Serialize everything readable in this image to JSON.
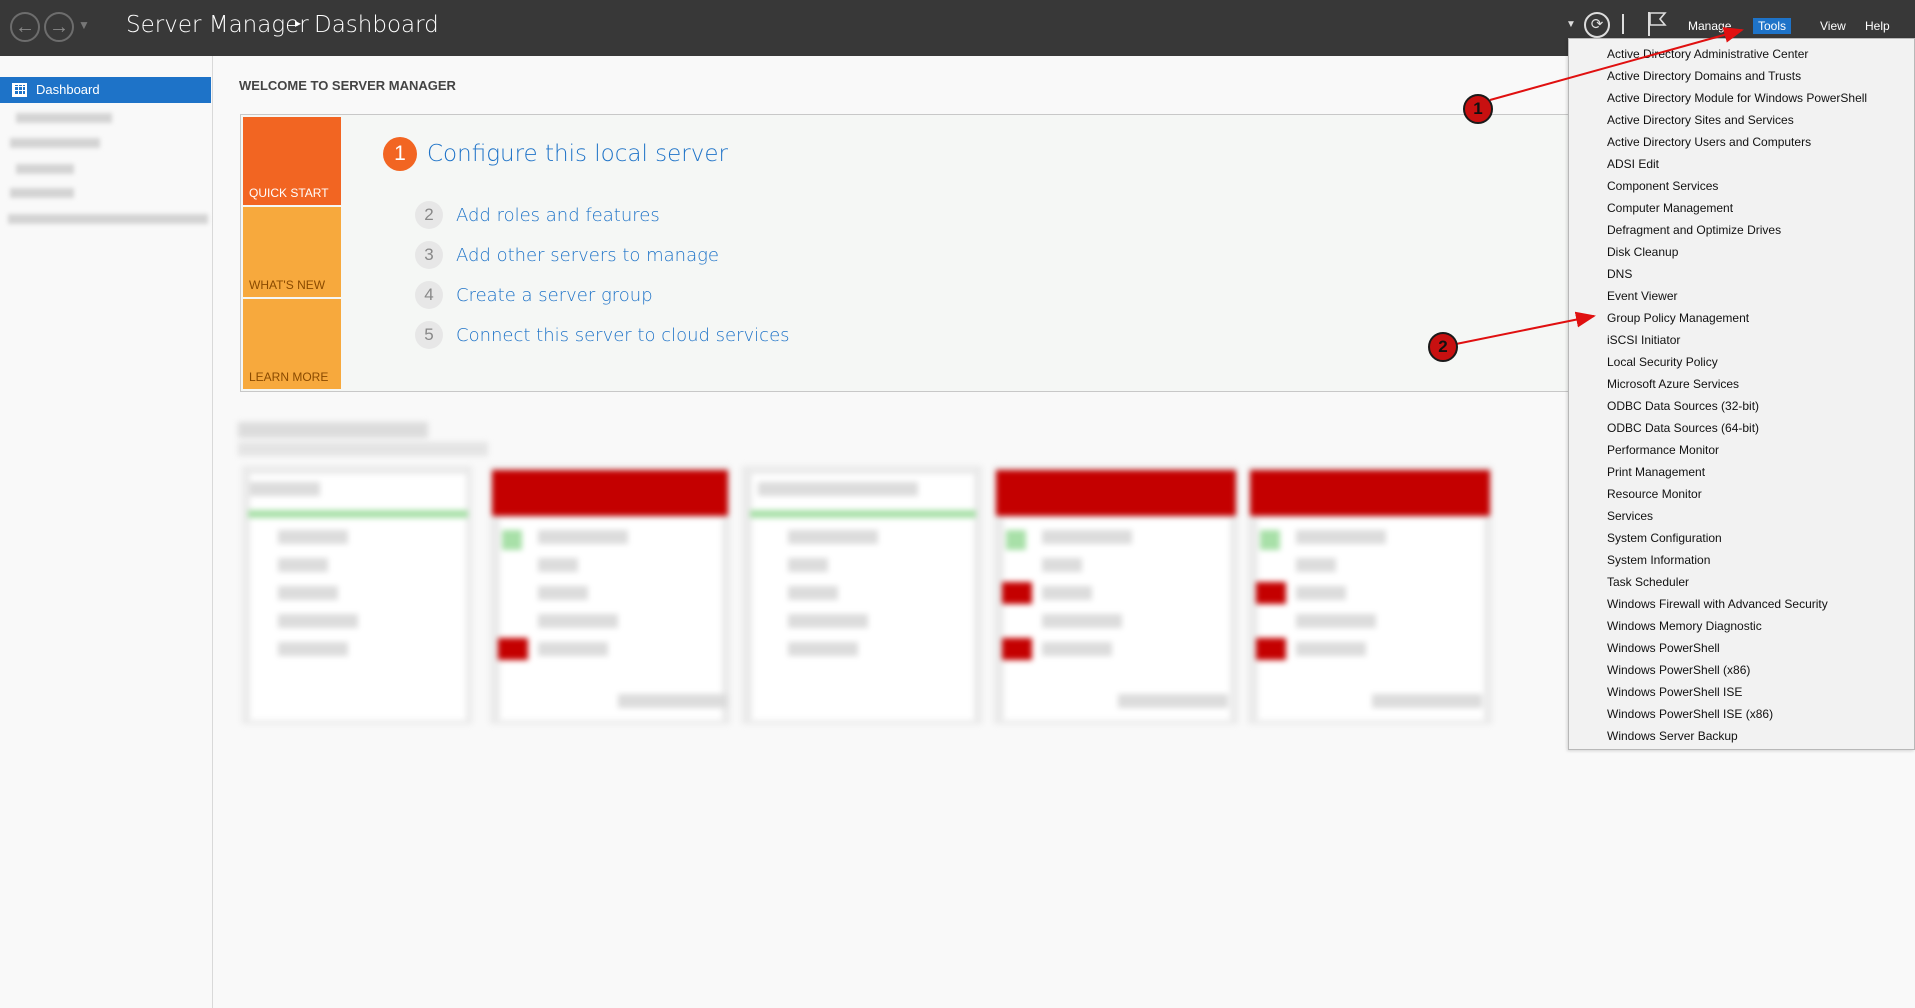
{
  "titlebar": {
    "back_icon": "←",
    "forward_icon": "→",
    "dropdown_icon": "▼",
    "app_title": "Server Manager",
    "separator": "▸",
    "page": "Dashboard",
    "refresh_icon": "⟳",
    "flag_icon": "flag-icon"
  },
  "menubar": {
    "manage": "Manage",
    "tools": "Tools",
    "view": "View",
    "help": "Help"
  },
  "sidebar": {
    "dashboard": "Dashboard"
  },
  "main": {
    "welcome": "WELCOME TO SERVER MANAGER",
    "tiles": {
      "quick_start": "QUICK START",
      "whats_new": "WHAT'S NEW",
      "learn_more": "LEARN MORE"
    },
    "step1": {
      "num": "1",
      "label": "Configure this local server"
    },
    "steps": [
      {
        "num": "2",
        "label": "Add roles and features"
      },
      {
        "num": "3",
        "label": "Add other servers to manage"
      },
      {
        "num": "4",
        "label": "Create a server group"
      },
      {
        "num": "5",
        "label": "Connect this server to cloud services"
      }
    ]
  },
  "tools_menu": {
    "items": [
      "Active Directory Administrative Center",
      "Active Directory Domains and Trusts",
      "Active Directory Module for Windows PowerShell",
      "Active Directory Sites and Services",
      "Active Directory Users and Computers",
      "ADSI Edit",
      "Component Services",
      "Computer Management",
      "Defragment and Optimize Drives",
      "Disk Cleanup",
      "DNS",
      "Event Viewer",
      "Group Policy Management",
      "iSCSI Initiator",
      "Local Security Policy",
      "Microsoft Azure Services",
      "ODBC Data Sources (32-bit)",
      "ODBC Data Sources (64-bit)",
      "Performance Monitor",
      "Print Management",
      "Resource Monitor",
      "Services",
      "System Configuration",
      "System Information",
      "Task Scheduler",
      "Windows Firewall with Advanced Security",
      "Windows Memory Diagnostic",
      "Windows PowerShell",
      "Windows PowerShell (x86)",
      "Windows PowerShell ISE",
      "Windows PowerShell ISE (x86)",
      "Windows Server Backup"
    ]
  },
  "annotations": {
    "badge_1": "1",
    "badge_2": "2",
    "color": "#e01010"
  }
}
